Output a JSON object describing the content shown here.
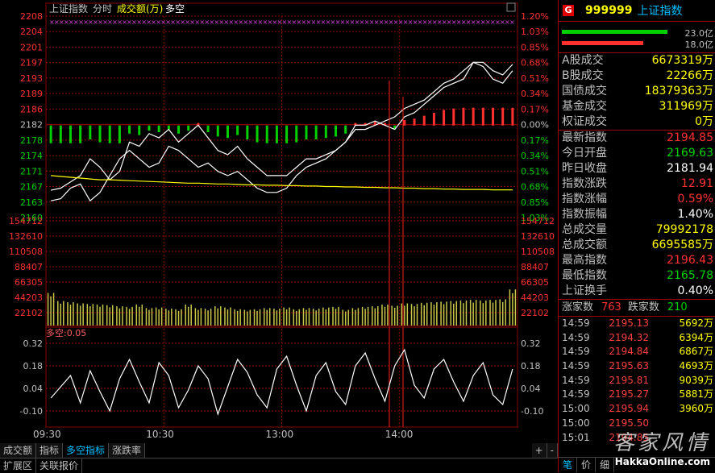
{
  "chart_header": {
    "index_name": "上证指数",
    "mode": "分时",
    "turnover_label": "成交额(万)",
    "multi_empty": "多空"
  },
  "indicator_header": {
    "label": "多空:0.05"
  },
  "colors": {
    "up": "#ff3030",
    "down": "#00d000",
    "price": "#ffffff",
    "avg": "#ffff00",
    "grid": "#8b0000",
    "axis_text_up": "#ff3030",
    "axis_text_flat": "#c0c0c0",
    "axis_text_down": "#00d000",
    "volume": "#c8c848",
    "marker": "#e040e0"
  },
  "chart_data": [
    {
      "type": "line",
      "y_ticks_left": [
        "2208",
        "2204",
        "2201",
        "2197",
        "2193",
        "2189",
        "2186",
        "2182",
        "2178",
        "2174",
        "2171",
        "2167",
        "2163",
        "2160"
      ],
      "y_ticks_right": [
        "1.20%",
        "1.03%",
        "0.85%",
        "0.68%",
        "0.51%",
        "0.34%",
        "0.17%",
        "0.00%",
        "0.17%",
        "0.34%",
        "0.51%",
        "0.68%",
        "0.85%",
        "1.03%"
      ],
      "ylim": [
        2160,
        2208
      ],
      "prev_close": 2181.94,
      "x_labels": [
        "09:30",
        "10:30",
        "13:00",
        "14:00"
      ],
      "series": [
        {
          "name": "price",
          "values": [
            2166.5,
            2167,
            2168.5,
            2170,
            2174,
            2172,
            2169,
            2171,
            2178,
            2177,
            2180,
            2179,
            2181,
            2178,
            2180,
            2182,
            2179,
            2176,
            2175,
            2177,
            2174,
            2172,
            2170,
            2170,
            2170,
            2172,
            2174,
            2174,
            2175,
            2176,
            2178,
            2182,
            2182,
            2183,
            2182,
            2181,
            2184,
            2185,
            2187,
            2189,
            2191,
            2192,
            2193,
            2197,
            2197,
            2195,
            2194,
            2196.5
          ]
        },
        {
          "name": "leader",
          "values": [
            2164,
            2164.5,
            2167,
            2168,
            2164,
            2166,
            2170,
            2174,
            2176,
            2174,
            2172,
            2173,
            2177,
            2176,
            2174,
            2172,
            2173,
            2171,
            2170,
            2171,
            2169,
            2167,
            2166,
            2166,
            2167,
            2170,
            2172,
            2173,
            2174,
            2176,
            2178,
            2181,
            2181,
            2182,
            2183,
            2184,
            2186,
            2187,
            2188,
            2190,
            2192,
            2193,
            2195,
            2197,
            2196,
            2193,
            2192,
            2195
          ]
        },
        {
          "name": "avg",
          "values": [
            2170,
            2169.8,
            2169.6,
            2169.4,
            2169.2,
            2169,
            2169,
            2168.9,
            2168.8,
            2168.7,
            2168.6,
            2168.5,
            2168.4,
            2168.3,
            2168.2,
            2168.2,
            2168.1,
            2168,
            2168,
            2167.9,
            2167.8,
            2167.8,
            2167.7,
            2167.7,
            2167.6,
            2167.6,
            2167.5,
            2167.5,
            2167.4,
            2167.4,
            2167.3,
            2167.3,
            2167.2,
            2167.2,
            2167.1,
            2167.1,
            2167,
            2167,
            2166.9,
            2166.9,
            2166.8,
            2166.8,
            2166.7,
            2166.7,
            2166.7,
            2166.6,
            2166.6,
            2166.6
          ]
        }
      ]
    },
    {
      "type": "bar",
      "y_ticks": [
        "154712",
        "132610",
        "110508",
        "88407",
        "66305",
        "44203",
        "22102"
      ],
      "ylim": [
        0,
        176000
      ],
      "series": [
        {
          "name": "volume",
          "values": [
            56000,
            42000,
            40000,
            38000,
            37000,
            36000,
            35000,
            33000,
            32000,
            36000,
            30000,
            31000,
            29000,
            28000,
            36000,
            30000,
            29000,
            33000,
            31000,
            28000,
            27000,
            28000,
            30000,
            29000,
            31000,
            28000,
            30000,
            29000,
            31000,
            32000,
            27000,
            30000,
            32000,
            33000,
            36000,
            34000,
            38000,
            37000,
            39000,
            40000,
            41000,
            42000,
            43000,
            44000,
            43000,
            44000,
            45000,
            62000
          ]
        }
      ]
    },
    {
      "type": "line",
      "y_ticks": [
        "0.32",
        "0.18",
        "0.04",
        "-0.10"
      ],
      "ylim": [
        -0.2,
        0.36
      ],
      "series": [
        {
          "name": "多空",
          "values": [
            -0.02,
            0.05,
            0.12,
            -0.05,
            0.15,
            0.02,
            -0.1,
            0.1,
            0.22,
            0.08,
            -0.05,
            0.2,
            0.12,
            -0.08,
            0.03,
            0.18,
            0.1,
            -0.12,
            0.05,
            0.22,
            0.14,
            0.0,
            -0.08,
            0.16,
            0.24,
            0.06,
            -0.1,
            0.12,
            0.2,
            0.02,
            -0.06,
            0.18,
            0.26,
            0.1,
            -0.04,
            0.18,
            0.28,
            0.06,
            -0.02,
            0.16,
            0.22,
            0.08,
            -0.04,
            0.12,
            0.2,
            0.0,
            -0.06,
            0.16
          ]
        }
      ]
    }
  ],
  "right_panel": {
    "badge": "G",
    "code": "999999",
    "name": "上证指数",
    "bars": [
      {
        "value": "23.0亿",
        "color": "#00d000"
      },
      {
        "value": "18.0亿",
        "color": "#ff3030"
      }
    ],
    "stats1": [
      {
        "label": "A股成交",
        "value": "6673319万",
        "color": "#ffff00"
      },
      {
        "label": "B股成交",
        "value": "22266万",
        "color": "#ffff00"
      },
      {
        "label": "国债成交",
        "value": "18379363万",
        "color": "#ffff00"
      },
      {
        "label": "基金成交",
        "value": "311969万",
        "color": "#ffff00"
      },
      {
        "label": "权证成交",
        "value": "0万",
        "color": "#ffff00"
      }
    ],
    "stats2": [
      {
        "label": "最新指数",
        "value": "2194.85",
        "color": "#ff3030"
      },
      {
        "label": "今日开盘",
        "value": "2169.63",
        "color": "#00d000"
      },
      {
        "label": "昨日收盘",
        "value": "2181.94",
        "color": "#ffffff"
      },
      {
        "label": "指数涨跌",
        "value": "12.91",
        "color": "#ff3030"
      },
      {
        "label": "指数涨幅",
        "value": "0.59%",
        "color": "#ff3030"
      },
      {
        "label": "指数振幅",
        "value": "1.40%",
        "color": "#ffffff"
      },
      {
        "label": "总成交量",
        "value": "79992178",
        "color": "#ffff00"
      },
      {
        "label": "总成交额",
        "value": "6695585万",
        "color": "#ffff00"
      },
      {
        "label": "最高指数",
        "value": "2196.43",
        "color": "#ff3030"
      },
      {
        "label": "最低指数",
        "value": "2165.78",
        "color": "#00d000"
      },
      {
        "label": "上证换手",
        "value": "0.40%",
        "color": "#ffffff"
      }
    ],
    "updown": {
      "up_label": "涨家数",
      "up_value": "763",
      "down_label": "跌家数",
      "down_value": "210"
    },
    "ticks": [
      {
        "time": "14:59",
        "price": "2195.13",
        "vol": "5692万"
      },
      {
        "time": "14:59",
        "price": "2194.32",
        "vol": "6394万"
      },
      {
        "time": "14:59",
        "price": "2194.84",
        "vol": "6867万"
      },
      {
        "time": "14:59",
        "price": "2195.63",
        "vol": "4693万"
      },
      {
        "time": "14:59",
        "price": "2195.81",
        "vol": "9039万"
      },
      {
        "time": "14:59",
        "price": "2195.27",
        "vol": "5881万"
      },
      {
        "time": "15:00",
        "price": "2195.94",
        "vol": "3960万"
      },
      {
        "time": "15:00",
        "price": "2195.50",
        "vol": ""
      },
      {
        "time": "15:01",
        "price": "2194.85",
        "vol": ""
      }
    ],
    "bottom_tabs": [
      "笔",
      "价",
      "细"
    ],
    "watermark": "客家风情",
    "watermark_url": "HakkaOnline.com"
  },
  "bottom_tabs": [
    "成交额",
    "指标",
    "多空指标",
    "涨跌率"
  ],
  "bottom_tabs_active": 2,
  "plus_minus": [
    "+",
    "-"
  ],
  "bottom_bar": [
    "扩展区",
    "关联报价"
  ]
}
